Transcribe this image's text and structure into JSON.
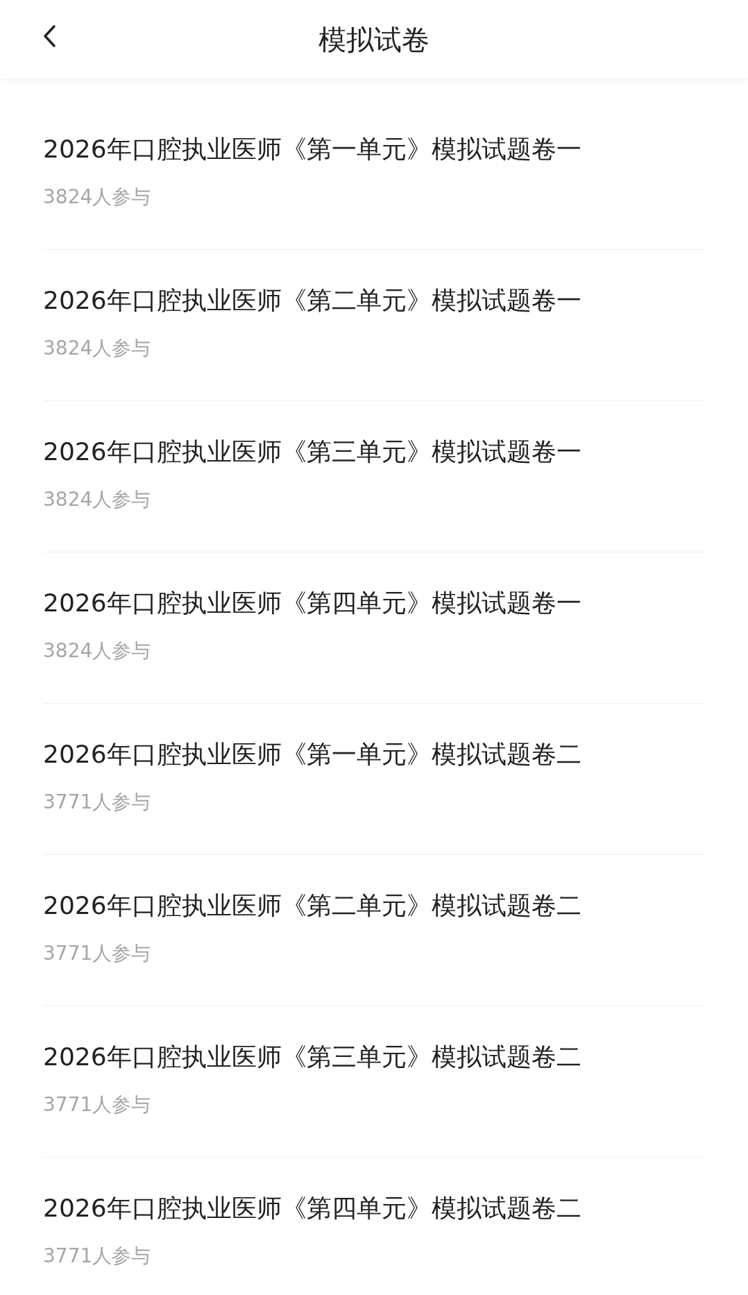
{
  "header": {
    "title": "模拟试卷"
  },
  "papers": [
    {
      "title": "2026年口腔执业医师《第一单元》模拟试题卷一",
      "participants": "3824人参与"
    },
    {
      "title": "2026年口腔执业医师《第二单元》模拟试题卷一",
      "participants": "3824人参与"
    },
    {
      "title": "2026年口腔执业医师《第三单元》模拟试题卷一",
      "participants": "3824人参与"
    },
    {
      "title": "2026年口腔执业医师《第四单元》模拟试题卷一",
      "participants": "3824人参与"
    },
    {
      "title": "2026年口腔执业医师《第一单元》模拟试题卷二",
      "participants": "3771人参与"
    },
    {
      "title": "2026年口腔执业医师《第二单元》模拟试题卷二",
      "participants": "3771人参与"
    },
    {
      "title": "2026年口腔执业医师《第三单元》模拟试题卷二",
      "participants": "3771人参与"
    },
    {
      "title": "2026年口腔执业医师《第四单元》模拟试题卷二",
      "participants": "3771人参与"
    }
  ]
}
